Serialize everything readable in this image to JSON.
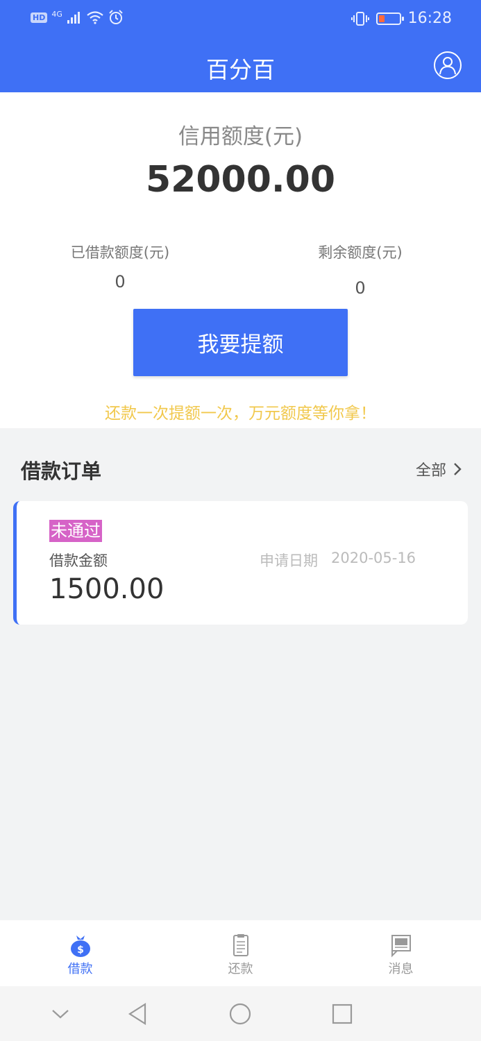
{
  "status_bar": {
    "hd": "HD",
    "network": "4G",
    "time": "16:28"
  },
  "header": {
    "title": "百分百"
  },
  "credit": {
    "label": "信用额度(元)",
    "value": "52000.00",
    "borrowed_label": "已借款额度(元)",
    "borrowed_value": "0",
    "remaining_label": "剩余额度(元)",
    "remaining_value": "0",
    "raise_button": "我要提额",
    "promo": "还款一次提额一次，万元额度等你拿！"
  },
  "orders": {
    "title": "借款订单",
    "all_label": "全部",
    "items": [
      {
        "status": "未通过",
        "amount_label": "借款金额",
        "amount": "1500.00",
        "date_label": "申请日期",
        "date": "2020-05-16"
      }
    ]
  },
  "tabs": [
    {
      "label": "借款",
      "icon": "money-bag-icon",
      "active": true
    },
    {
      "label": "还款",
      "icon": "clipboard-icon",
      "active": false
    },
    {
      "label": "消息",
      "icon": "message-icon",
      "active": false
    }
  ],
  "colors": {
    "primary": "#3f70f5",
    "promo": "#f1c84c",
    "rejected_badge": "#d663c7"
  }
}
